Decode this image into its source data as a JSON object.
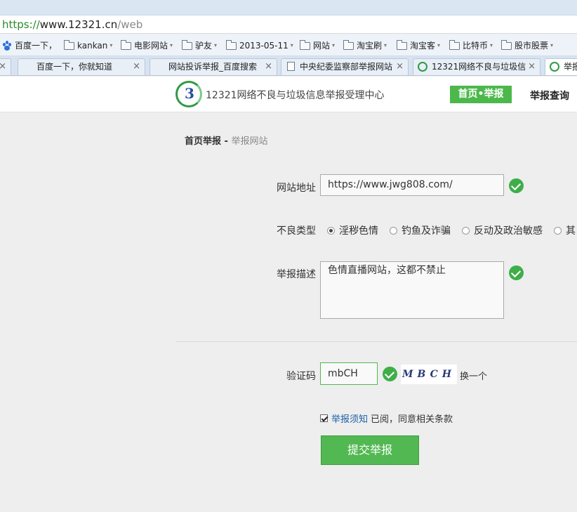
{
  "browser": {
    "url": {
      "scheme": "https://",
      "host": "www.12321.cn",
      "path": "/web"
    },
    "bookmarks": [
      {
        "label": "百度一下，",
        "icon": "baidu-paw-icon",
        "caret": ""
      },
      {
        "label": "kankan",
        "icon": "folder-icon",
        "caret": "▾"
      },
      {
        "label": "电影网站",
        "icon": "folder-icon",
        "caret": "▾"
      },
      {
        "label": "驴友",
        "icon": "folder-icon",
        "caret": "▾"
      },
      {
        "label": "2013-05-11",
        "icon": "folder-icon",
        "caret": "▾"
      },
      {
        "label": "网站",
        "icon": "folder-icon",
        "caret": "▾"
      },
      {
        "label": "淘宝刷",
        "icon": "folder-icon",
        "caret": "▾"
      },
      {
        "label": "淘宝客",
        "icon": "folder-icon",
        "caret": "▾"
      },
      {
        "label": "比特币",
        "icon": "folder-icon",
        "caret": "▾"
      },
      {
        "label": "股市股票",
        "icon": "folder-icon",
        "caret": "▾"
      }
    ],
    "tabs": [
      {
        "label": "百度一下，你就知道",
        "close": "×"
      },
      {
        "label": "网站投诉举报_百度搜索",
        "close": "×"
      },
      {
        "label": "中央纪委监察部举报网站",
        "close": "×"
      },
      {
        "label": "12321网络不良与垃圾信",
        "close": "×"
      },
      {
        "label": "举报",
        "close": ""
      }
    ]
  },
  "site": {
    "logo_text": "3",
    "title": "12321网络不良与垃圾信息举报受理中心",
    "nav_active": "首页•举报",
    "nav_query": "举报查询"
  },
  "breadcrumb": {
    "home": "首页举报",
    "sep": " - ",
    "current": "举报网站"
  },
  "form": {
    "url_label": "网站地址",
    "url_value": "https://www.jwg808.com/",
    "type_label": "不良类型",
    "types": [
      "淫秽色情",
      "钓鱼及诈骗",
      "反动及政治敏感",
      "其"
    ],
    "desc_label": "举报描述",
    "desc_value": "色情直播网站，这都不禁止",
    "captcha_label": "验证码",
    "captcha_value": "mbCH",
    "captcha_image_text": "MBCH",
    "refresh": "换一个",
    "agree_link": "举报须知",
    "agree_rest": "已阅，同意相关条款",
    "submit": "提交举报"
  },
  "colors": {
    "accent_green": "#4cb84c",
    "link_blue": "#1b5fa8"
  }
}
